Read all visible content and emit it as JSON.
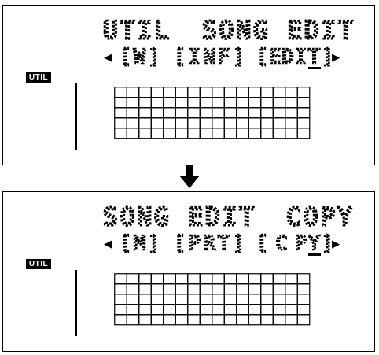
{
  "panels": [
    {
      "id": "top",
      "line1": {
        "left": "UTIL",
        "right": "SONG EDIT"
      },
      "line2": {
        "left_arrow": "◀",
        "tab1": "[W]",
        "tab2": "[INF]",
        "tab3": "[EDI",
        "cursor": "T",
        "tab3_end": "]",
        "right_arrow": "▶"
      },
      "badge": "UTIL",
      "grid": {
        "columns": 16,
        "rows": 5
      }
    },
    {
      "id": "bottom",
      "line1": {
        "left": "SONG EDIT",
        "right": "COPY"
      },
      "line2": {
        "left_arrow": "◀",
        "tab1": "[M]",
        "tab2": "[PRT]",
        "tab3": "[CP",
        "cursor": "Y",
        "tab3_end": "]",
        "right_arrow": "▶"
      },
      "badge": "UTIL",
      "grid": {
        "columns": 16,
        "rows": 5
      }
    }
  ],
  "transition": {
    "icon": "down-arrow-icon"
  }
}
